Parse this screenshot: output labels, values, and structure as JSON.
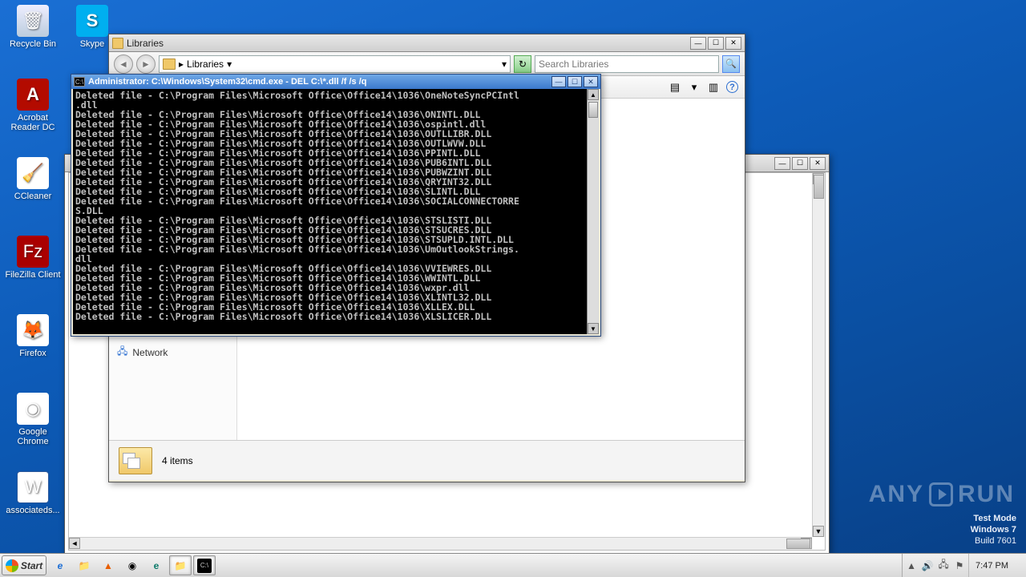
{
  "desktop_icons": [
    {
      "name": "recycle-bin",
      "label": "Recycle Bin",
      "glyph": "🗑"
    },
    {
      "name": "skype",
      "label": "Skype",
      "glyph": "S"
    },
    {
      "name": "acrobat",
      "label": "Acrobat\nReader DC",
      "glyph": "A"
    },
    {
      "name": "ccleaner",
      "label": "CCleaner",
      "glyph": "🧹"
    },
    {
      "name": "filezilla",
      "label": "FileZilla Client",
      "glyph": "Fz"
    },
    {
      "name": "firefox",
      "label": "Firefox",
      "glyph": "🦊"
    },
    {
      "name": "chrome",
      "label": "Google\nChrome",
      "glyph": "◉"
    },
    {
      "name": "word-doc",
      "label": "associateds...",
      "glyph": "W"
    }
  ],
  "libs_window": {
    "title": "Libraries",
    "address": "Libraries",
    "address_arrow": "▸",
    "search_placeholder": "Search Libraries",
    "status": "4 items",
    "sidebar_network": "Network"
  },
  "cmd_window": {
    "title": "Administrator: C:\\Windows\\System32\\cmd.exe - DEL  C:\\*.dll /f /s /q",
    "lines": [
      "Deleted file - C:\\Program Files\\Microsoft Office\\Office14\\1036\\OneNoteSyncPCIntl",
      ".dll",
      "Deleted file - C:\\Program Files\\Microsoft Office\\Office14\\1036\\ONINTL.DLL",
      "Deleted file - C:\\Program Files\\Microsoft Office\\Office14\\1036\\ospintl.dll",
      "Deleted file - C:\\Program Files\\Microsoft Office\\Office14\\1036\\OUTLLIBR.DLL",
      "Deleted file - C:\\Program Files\\Microsoft Office\\Office14\\1036\\OUTLWVW.DLL",
      "Deleted file - C:\\Program Files\\Microsoft Office\\Office14\\1036\\PPINTL.DLL",
      "Deleted file - C:\\Program Files\\Microsoft Office\\Office14\\1036\\PUB6INTL.DLL",
      "Deleted file - C:\\Program Files\\Microsoft Office\\Office14\\1036\\PUBWZINT.DLL",
      "Deleted file - C:\\Program Files\\Microsoft Office\\Office14\\1036\\QRYINT32.DLL",
      "Deleted file - C:\\Program Files\\Microsoft Office\\Office14\\1036\\SLINTL.DLL",
      "Deleted file - C:\\Program Files\\Microsoft Office\\Office14\\1036\\SOCIALCONNECTORRE",
      "S.DLL",
      "Deleted file - C:\\Program Files\\Microsoft Office\\Office14\\1036\\STSLISTI.DLL",
      "Deleted file - C:\\Program Files\\Microsoft Office\\Office14\\1036\\STSUCRES.DLL",
      "Deleted file - C:\\Program Files\\Microsoft Office\\Office14\\1036\\STSUPLD.INTL.DLL",
      "Deleted file - C:\\Program Files\\Microsoft Office\\Office14\\1036\\UmOutlookStrings.",
      "dll",
      "Deleted file - C:\\Program Files\\Microsoft Office\\Office14\\1036\\VVIEWRES.DLL",
      "Deleted file - C:\\Program Files\\Microsoft Office\\Office14\\1036\\WWINTL.DLL",
      "Deleted file - C:\\Program Files\\Microsoft Office\\Office14\\1036\\wxpr.dll",
      "Deleted file - C:\\Program Files\\Microsoft Office\\Office14\\1036\\XLINTL32.DLL",
      "Deleted file - C:\\Program Files\\Microsoft Office\\Office14\\1036\\XLLEX.DLL",
      "Deleted file - C:\\Program Files\\Microsoft Office\\Office14\\1036\\XLSLICER.DLL"
    ]
  },
  "watermark": {
    "anyrun": "ANY   RUN",
    "line1": "Test Mode",
    "line2": "Windows 7",
    "line3": "Build 7601"
  },
  "taskbar": {
    "start": "Start",
    "clock": "7:47 PM"
  },
  "glyphs": {
    "min": "—",
    "max": "☐",
    "close": "✕",
    "back": "◄",
    "fwd": "►",
    "dd": "▾",
    "refresh": "↻",
    "search": "🔍",
    "view": "▤",
    "pane": "▥",
    "help": "?",
    "up": "▲",
    "down": "▼",
    "left": "◄",
    "right": "►",
    "speaker": "🔊",
    "net": "🖧",
    "flag": "⚑",
    "ie": "e",
    "folder": "📁",
    "vlc": "▲",
    "chrome": "◉",
    "edge": "e",
    "cmd": "▮"
  }
}
